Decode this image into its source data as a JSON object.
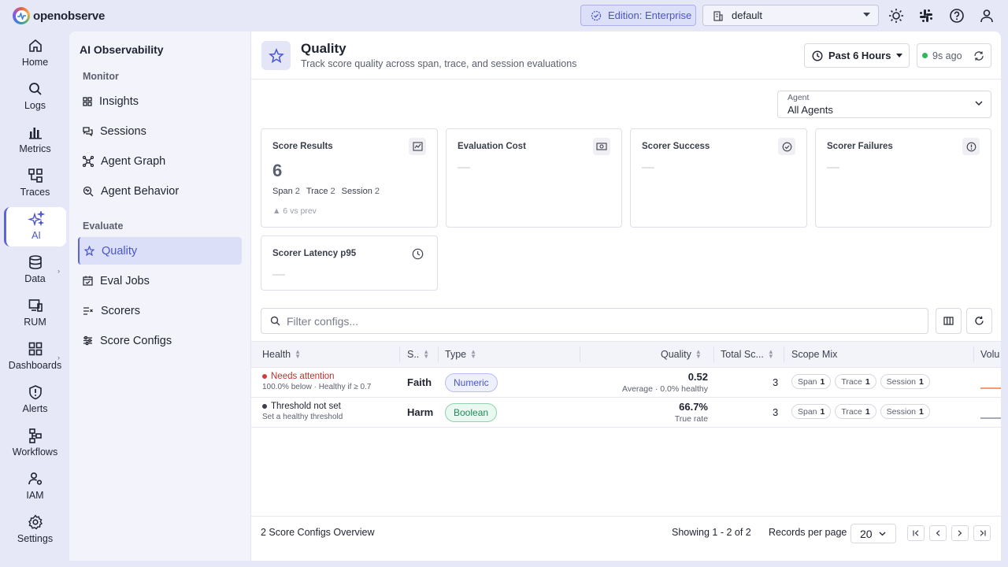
{
  "topbar": {
    "brand": "openobserve",
    "edition": "Edition: Enterprise",
    "org": "default"
  },
  "rail": [
    {
      "label": "Home",
      "icon": "home-icon"
    },
    {
      "label": "Logs",
      "icon": "search-icon"
    },
    {
      "label": "Metrics",
      "icon": "bar-chart-icon"
    },
    {
      "label": "Traces",
      "icon": "traces-icon"
    },
    {
      "label": "AI",
      "icon": "sparkle-icon"
    },
    {
      "label": "Data",
      "icon": "database-icon"
    },
    {
      "label": "RUM",
      "icon": "monitor-icon"
    },
    {
      "label": "Dashboards",
      "icon": "dashboard-icon"
    },
    {
      "label": "Alerts",
      "icon": "shield-alert-icon"
    },
    {
      "label": "Workflows",
      "icon": "workflow-icon"
    },
    {
      "label": "IAM",
      "icon": "users-icon"
    },
    {
      "label": "Settings",
      "icon": "gear-icon"
    }
  ],
  "subnav": {
    "title": "AI Observability",
    "monitor_label": "Monitor",
    "monitor_items": [
      "Insights",
      "Sessions",
      "Agent Graph",
      "Agent Behavior"
    ],
    "evaluate_label": "Evaluate",
    "evaluate_items": [
      "Quality",
      "Eval Jobs",
      "Scorers",
      "Score Configs"
    ]
  },
  "header": {
    "title": "Quality",
    "subtitle": "Track score quality across span, trace, and session evaluations",
    "time_range": "Past 6 Hours",
    "refreshed": "9s ago"
  },
  "agent": {
    "caption": "Agent",
    "value": "All Agents"
  },
  "cards": {
    "score_results": {
      "title": "Score Results",
      "value": "6",
      "span_label": "Span",
      "span_val": "2",
      "trace_label": "Trace",
      "trace_val": "2",
      "session_label": "Session",
      "session_val": "2",
      "prev": "▲ 6 vs prev"
    },
    "eval_cost": {
      "title": "Evaluation Cost",
      "value": "—"
    },
    "scorer_success": {
      "title": "Scorer Success",
      "value": "—"
    },
    "scorer_failures": {
      "title": "Scorer Failures",
      "value": "—"
    },
    "scorer_latency": {
      "title": "Scorer Latency p95",
      "value": "—"
    }
  },
  "filter": {
    "placeholder": "Filter configs..."
  },
  "table": {
    "headers": {
      "health": "Health",
      "s": "S..",
      "type": "Type",
      "quality": "Quality",
      "total": "Total Sc...",
      "scope": "Scope Mix",
      "volume": "Volu"
    },
    "rows": [
      {
        "status": "Needs attention",
        "status_color": "#d63b3b",
        "status_sub": "100.0% below · Healthy if ≥ 0.7",
        "name": "Faith",
        "type": "Numeric",
        "quality": "0.52",
        "quality_sub": "Average · 0.0% healthy",
        "total": "3",
        "span_label": "Span",
        "span": "1",
        "trace_label": "Trace",
        "trace": "1",
        "session_label": "Session",
        "session": "1",
        "spark_color": "#f07b3a"
      },
      {
        "status": "Threshold not set",
        "status_color": "#3b3f4c",
        "status_sub": "Set a healthy threshold",
        "name": "Harm",
        "type": "Boolean",
        "quality": "66.7%",
        "quality_sub": "True rate",
        "total": "3",
        "span_label": "Span",
        "span": "1",
        "trace_label": "Trace",
        "trace": "1",
        "session_label": "Session",
        "session": "1",
        "spark_color": "#8a8d99"
      }
    ]
  },
  "footer": {
    "overview": "2 Score Configs Overview",
    "showing": "Showing 1 - 2 of 2",
    "rpp_label": "Records per page",
    "rpp_value": "20"
  },
  "colors": {
    "accent": "#5b65d6",
    "accent_bg": "#dcdff8",
    "app_bg": "#e7e8f7"
  }
}
